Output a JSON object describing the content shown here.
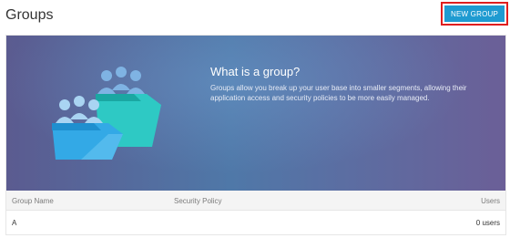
{
  "header": {
    "title": "Groups",
    "new_group_label": "NEW GROUP"
  },
  "hero": {
    "heading": "What is a group?",
    "description": "Groups allow you break up your user base into smaller segments, allowing their application access and security policies to be more easily managed.",
    "illustration_icon": "group-folders-icon"
  },
  "table": {
    "columns": [
      "Group Name",
      "Security Policy",
      "Users"
    ],
    "rows": [
      {
        "name": "A",
        "policy": "",
        "users": "0 users"
      }
    ]
  },
  "colors": {
    "accent": "#1f9bd1",
    "highlight": "#e01e1e",
    "hero_start": "#5b5b90",
    "hero_end": "#6b5f97"
  }
}
